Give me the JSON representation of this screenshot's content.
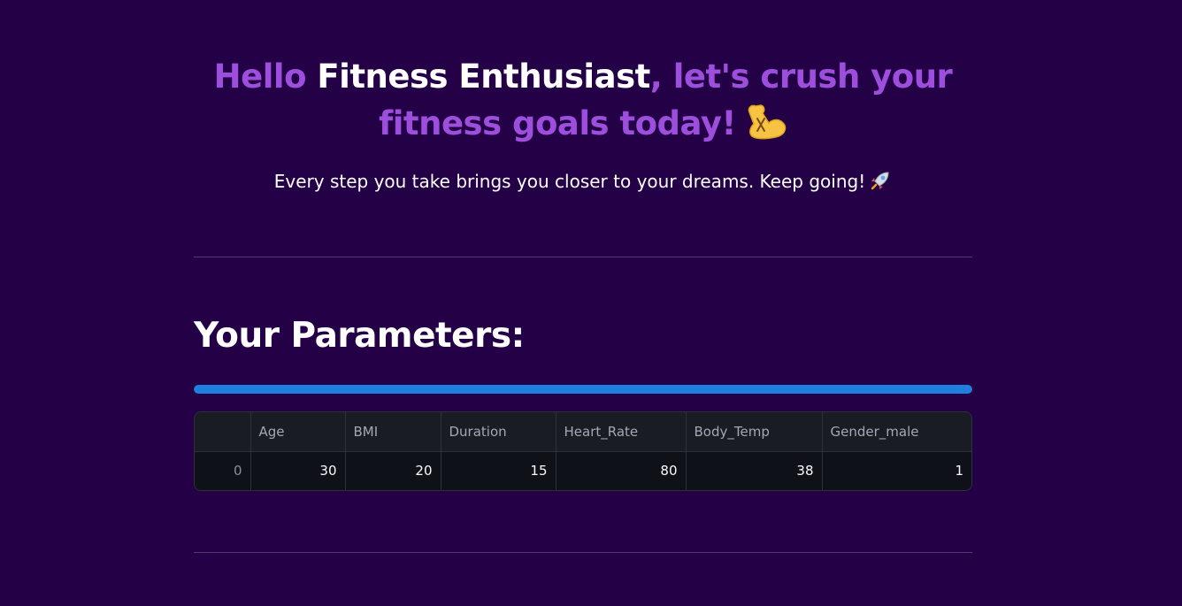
{
  "header": {
    "greeting_start": "Hello ",
    "user_name": "Fitness Enthusiast",
    "greeting_end": ", let's crush your fitness goals today!",
    "muscle_emoji_icon": "flexed-biceps-icon",
    "tagline": "Every step you take brings you closer to your dreams. Keep going!",
    "rocket_emoji_icon": "rocket-icon"
  },
  "parameters": {
    "title": "Your Parameters:",
    "progress_percent": 100,
    "progress_color": "#1f7fdc",
    "table": {
      "columns": [
        "",
        "Age",
        "BMI",
        "Duration",
        "Heart_Rate",
        "Body_Temp",
        "Gender_male"
      ],
      "rows": [
        {
          "index": "0",
          "Age": "30",
          "BMI": "20",
          "Duration": "15",
          "Heart_Rate": "80",
          "Body_Temp": "38",
          "Gender_male": "1"
        }
      ]
    }
  },
  "colors": {
    "background": "#240046",
    "accent_purple": "#9d4edd"
  }
}
